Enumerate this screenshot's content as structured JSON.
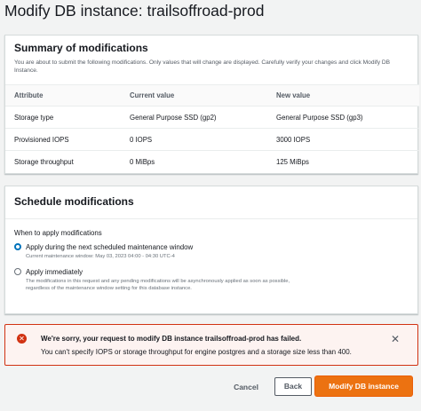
{
  "page": {
    "title": "Modify DB instance: trailsoffroad-prod"
  },
  "summary": {
    "title": "Summary of modifications",
    "description": "You are about to submit the following modifications. Only values that will change are displayed. Carefully verify your changes and click Modify DB Instance.",
    "columns": [
      "Attribute",
      "Current value",
      "New value"
    ],
    "rows": [
      [
        "Storage type",
        "General Purpose SSD (gp2)",
        "General Purpose SSD (gp3)"
      ],
      [
        "Provisioned IOPS",
        "0 IOPS",
        "3000 IOPS"
      ],
      [
        "Storage throughput",
        "0 MiBps",
        "125 MiBps"
      ]
    ]
  },
  "schedule": {
    "title": "Schedule modifications",
    "when_label": "When to apply modifications",
    "options": [
      {
        "label": "Apply during the next scheduled maintenance window",
        "description": "Current maintenance window: May 03, 2023 04:00 - 04:30 UTC-4",
        "selected": true
      },
      {
        "label": "Apply immediately",
        "description": "The modifications in this request and any pending modifications will be asynchronously applied as soon as possible, regardless of the maintenance window setting for this database instance.",
        "selected": false
      }
    ]
  },
  "alert": {
    "icon": "error-icon",
    "title": "We're sorry, your request to modify DB instance trailsoffroad-prod has failed.",
    "message": "You can't specify IOPS or storage throughput for engine postgres and a storage size less than 400.",
    "color": "#d13212"
  },
  "footer": {
    "cancel_label": "Cancel",
    "back_label": "Back",
    "submit_label": "Modify DB instance",
    "primary_color": "#ec7211"
  }
}
